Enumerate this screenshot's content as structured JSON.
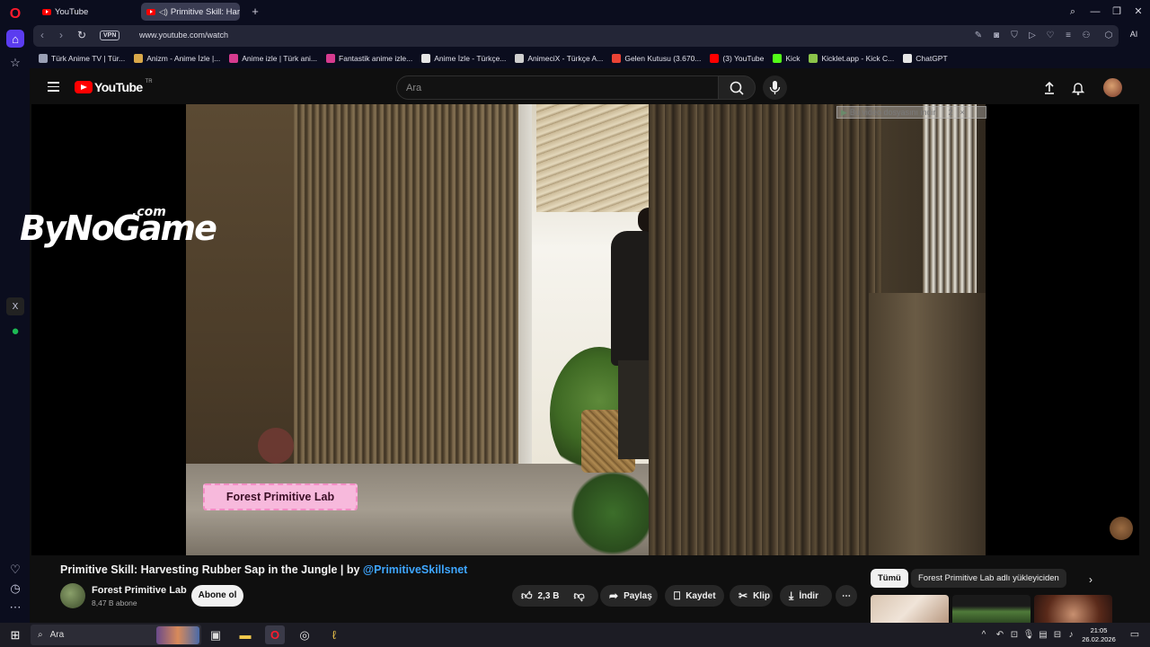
{
  "browser": {
    "tabs": [
      {
        "label": "YouTube",
        "active": false
      },
      {
        "label": "Primitive Skill: Harvest",
        "active": true
      }
    ],
    "new_tab_icon": "plus-icon",
    "vpn_label": "VPN",
    "url": "www.youtube.com/watch",
    "ai_label": "AI",
    "bookmarks": [
      {
        "label": "Türk Anime TV | Tür...",
        "color": "#9aa0b5"
      },
      {
        "label": "Anizm - Anime İzle |...",
        "color": "#d9a84a"
      },
      {
        "label": "Anime izle | Türk ani...",
        "color": "#d63b8f"
      },
      {
        "label": "Fantastik anime izle...",
        "color": "#d63b8f"
      },
      {
        "label": "Anime İzle - Türkçe...",
        "color": "#e6e6e6"
      },
      {
        "label": "AnimeciX - Türkçe A...",
        "color": "#cfcfcf"
      },
      {
        "label": "Gelen Kutusu (3.670...",
        "color": "#ea4335"
      },
      {
        "label": "(3) YouTube",
        "color": "#ff0000"
      },
      {
        "label": "Kick",
        "color": "#53fc18"
      },
      {
        "label": "Kicklet.app - Kick C...",
        "color": "#8bc34a"
      },
      {
        "label": "ChatGPT",
        "color": "#e6e6e6"
      }
    ]
  },
  "youtube": {
    "logo_text": "YouTube",
    "country_code": "TR",
    "search_placeholder": "Ara",
    "video": {
      "brand_tag": "Forest Primitive Lab",
      "download_banner": "Bu video dosyasını indir",
      "download_banner_count": "2",
      "close_glyph": "×"
    },
    "title_main": "Primitive Skill: Harvesting Rubber Sap in the Jungle | by ",
    "title_handle": "@PrimitiveSkillsnet",
    "channel_name": "Forest Primitive Lab",
    "subscribers": "8,47 B abone",
    "subscribe_label": "Abone ol",
    "like_count": "2,3 B",
    "share_label": "Paylaş",
    "save_label": "Kaydet",
    "clip_label": "Klip",
    "download_label": "İndir",
    "chips": [
      "Tümü",
      "Forest Primitive Lab adlı yükleyiciden"
    ]
  },
  "watermark": {
    "text": "ByNoGame",
    "suffix": ".com"
  },
  "taskbar": {
    "search_placeholder": "Ara",
    "time": "21:05",
    "date": "26.02.2026"
  },
  "colors": {
    "accent_link": "#3ea6ff",
    "youtube_red": "#ff0000",
    "brand_tag_bg": "#f7b9dc"
  }
}
